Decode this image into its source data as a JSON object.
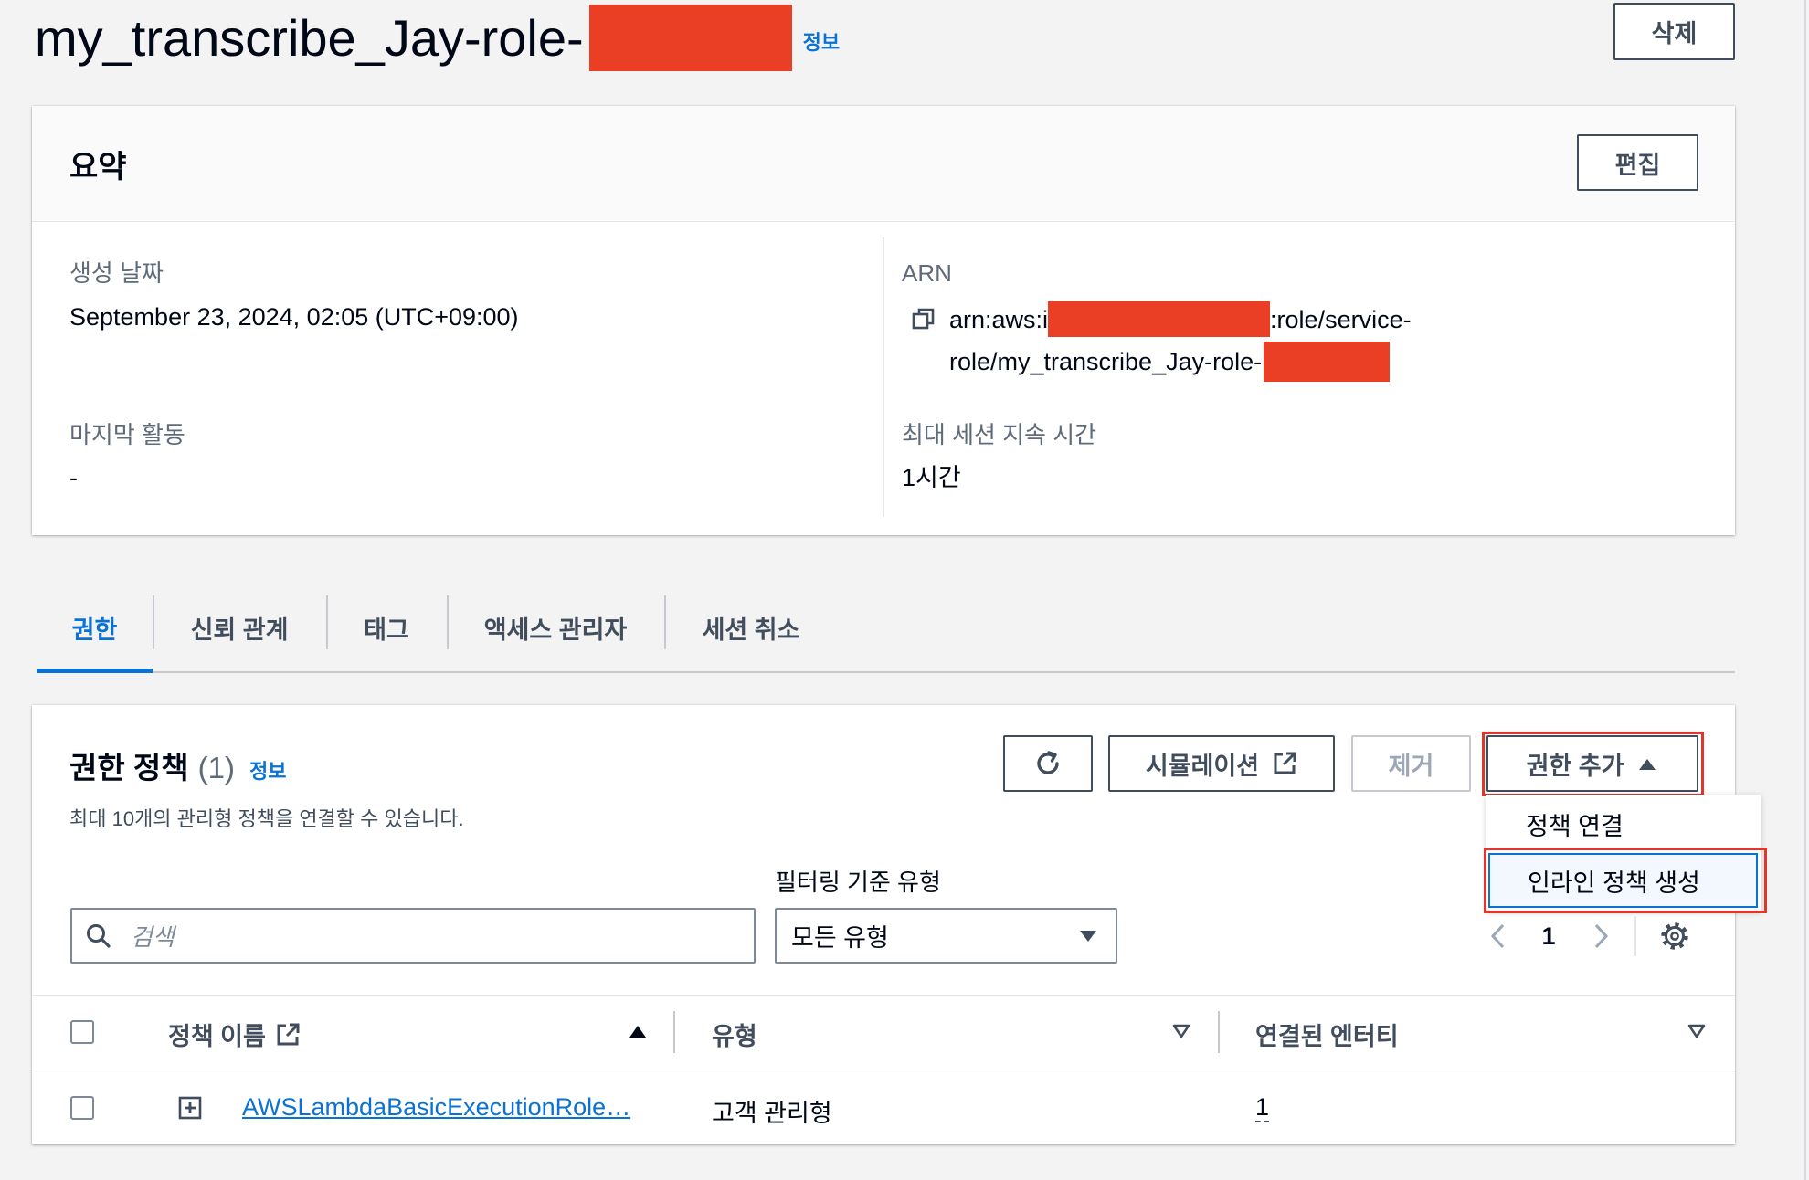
{
  "page": {
    "title": "my_transcribe_Jay-role-",
    "info_link": "정보",
    "delete_button": "삭제"
  },
  "summary": {
    "heading": "요약",
    "edit_button": "편집",
    "created_label": "생성 날짜",
    "created_value": "September 23, 2024, 02:05 (UTC+09:00)",
    "arn_label": "ARN",
    "arn_line1_prefix": "arn:aws:i",
    "arn_line1_suffix": ":role/service-",
    "arn_line2": "role/my_transcribe_Jay-role-",
    "last_activity_label": "마지막 활동",
    "last_activity_value": "-",
    "max_session_label": "최대 세션 지속 시간",
    "max_session_value": "1시간"
  },
  "tabs": [
    {
      "label": "권한",
      "active": true
    },
    {
      "label": "신뢰 관계",
      "active": false
    },
    {
      "label": "태그",
      "active": false
    },
    {
      "label": "액세스 관리자",
      "active": false
    },
    {
      "label": "세션 취소",
      "active": false
    }
  ],
  "permissions": {
    "heading": "권한 정책",
    "count": "(1)",
    "info_link": "정보",
    "description": "최대 10개의 관리형 정책을 연결할 수 있습니다.",
    "simulate_button": "시뮬레이션",
    "remove_button": "제거",
    "add_button": "권한 추가",
    "add_menu": [
      "정책 연결",
      "인라인 정책 생성"
    ],
    "filter_label": "필터링 기준 유형",
    "search_placeholder": "검색",
    "type_select": "모든 유형",
    "page_number": "1",
    "columns": [
      "정책 이름",
      "유형",
      "연결된 엔터티"
    ],
    "rows": [
      {
        "name": "AWSLambdaBasicExecutionRole…",
        "type": "고객 관리형",
        "entities": "1"
      }
    ]
  },
  "icons": [
    "copy-icon",
    "refresh-icon",
    "external-link-icon",
    "caret-up-icon",
    "search-icon",
    "caret-down-icon",
    "chevron-left-icon",
    "chevron-right-icon",
    "gear-icon",
    "expand-icon",
    "sort-ascending-icon",
    "sort-icon"
  ],
  "colors": {
    "accent": "#0972d3",
    "text": "#000716",
    "label": "#5f6b7a",
    "redaction": "#ea3f25",
    "annotation_outline": "#e0362b"
  }
}
